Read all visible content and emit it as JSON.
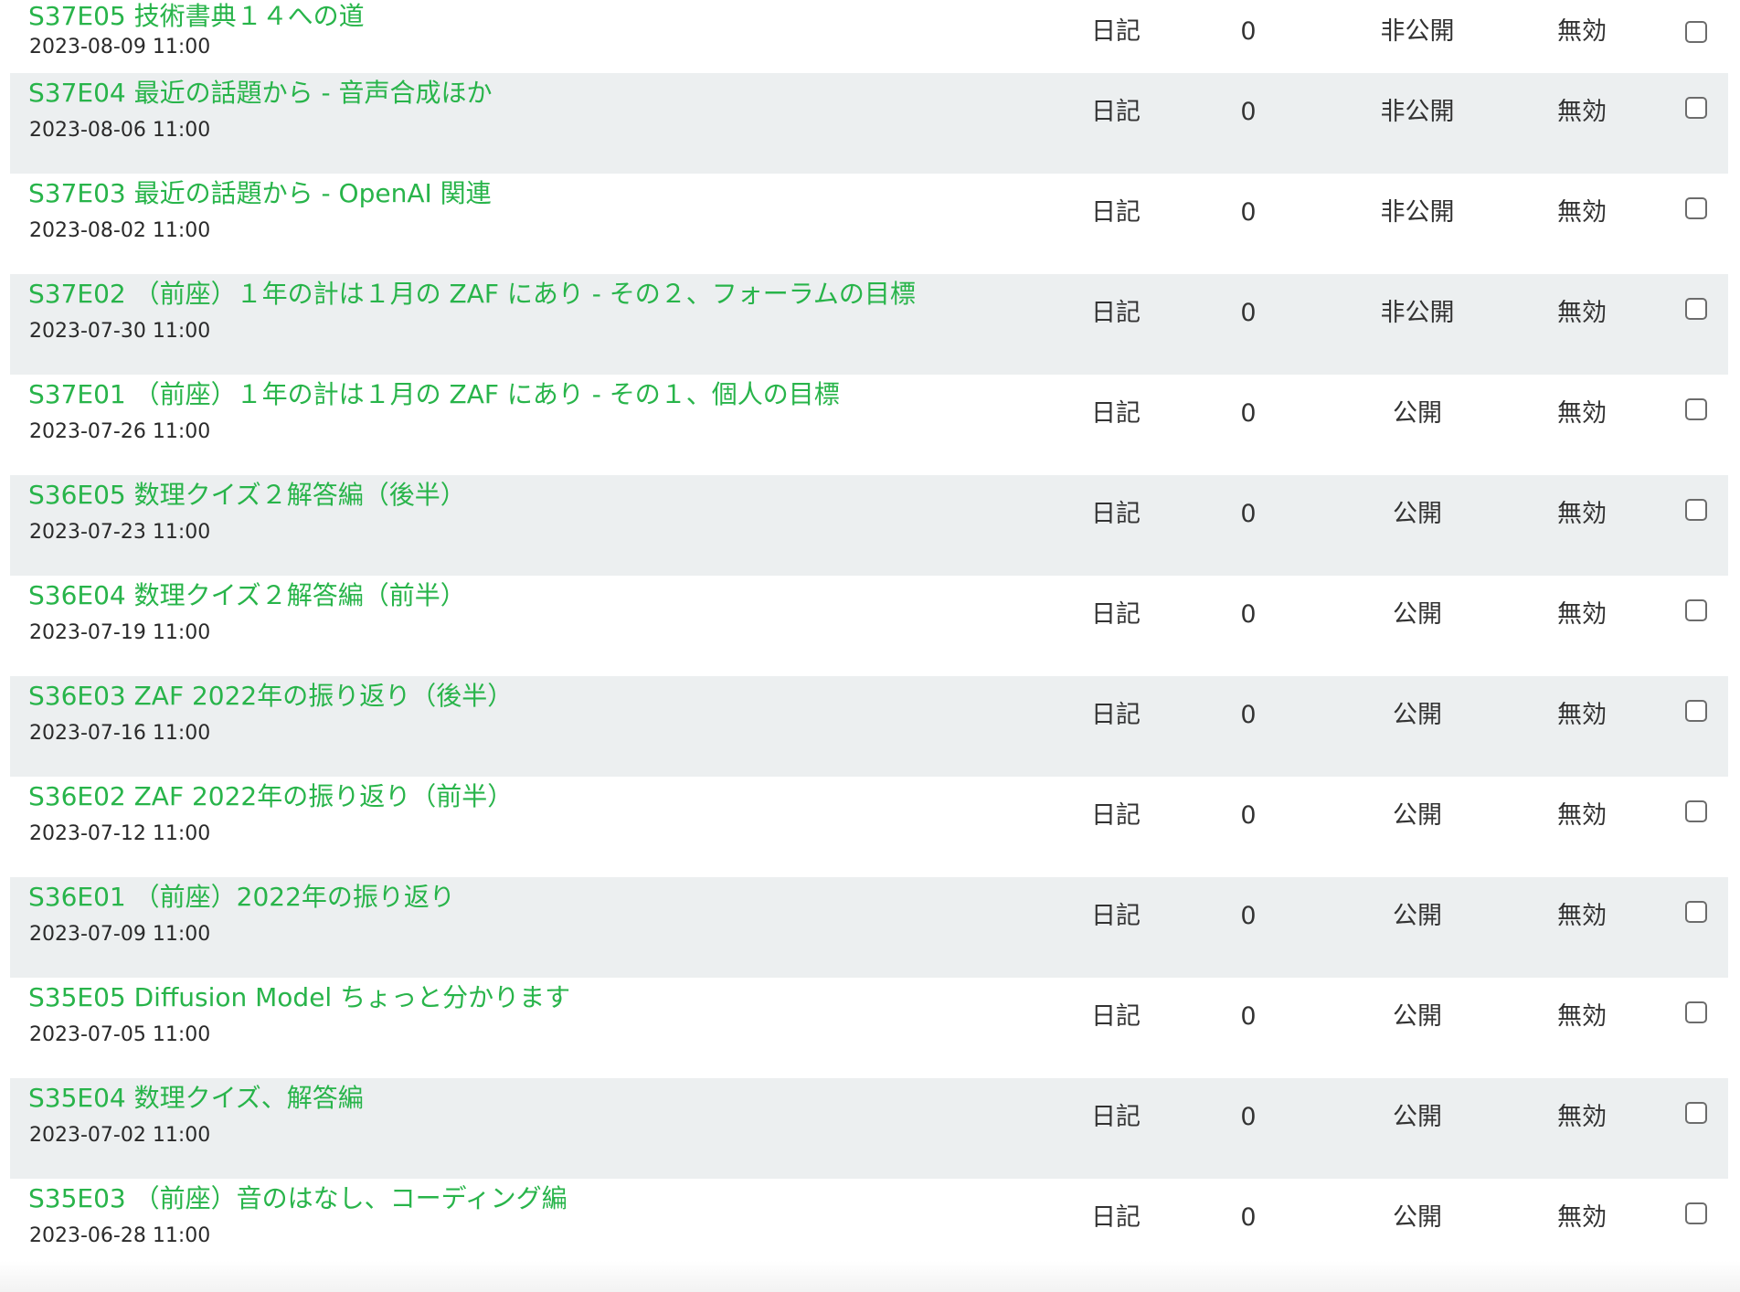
{
  "rows": [
    {
      "title": "S37E05 技術書典１４への道",
      "date": "2023-08-09 11:00",
      "category": "日記",
      "count": "0",
      "visibility": "非公開",
      "status": "無効"
    },
    {
      "title": "S37E04 最近の話題から - 音声合成ほか",
      "date": "2023-08-06 11:00",
      "category": "日記",
      "count": "0",
      "visibility": "非公開",
      "status": "無効"
    },
    {
      "title": "S37E03 最近の話題から - OpenAI 関連",
      "date": "2023-08-02 11:00",
      "category": "日記",
      "count": "0",
      "visibility": "非公開",
      "status": "無効"
    },
    {
      "title": "S37E02 （前座）１年の計は１月の ZAF にあり - その２、フォーラムの目標",
      "date": "2023-07-30 11:00",
      "category": "日記",
      "count": "0",
      "visibility": "非公開",
      "status": "無効"
    },
    {
      "title": "S37E01 （前座）１年の計は１月の ZAF にあり - その１、個人の目標",
      "date": "2023-07-26 11:00",
      "category": "日記",
      "count": "0",
      "visibility": "公開",
      "status": "無効"
    },
    {
      "title": "S36E05 数理クイズ２解答編（後半）",
      "date": "2023-07-23 11:00",
      "category": "日記",
      "count": "0",
      "visibility": "公開",
      "status": "無効"
    },
    {
      "title": "S36E04 数理クイズ２解答編（前半）",
      "date": "2023-07-19 11:00",
      "category": "日記",
      "count": "0",
      "visibility": "公開",
      "status": "無効"
    },
    {
      "title": "S36E03 ZAF 2022年の振り返り（後半）",
      "date": "2023-07-16 11:00",
      "category": "日記",
      "count": "0",
      "visibility": "公開",
      "status": "無効"
    },
    {
      "title": "S36E02 ZAF 2022年の振り返り（前半）",
      "date": "2023-07-12 11:00",
      "category": "日記",
      "count": "0",
      "visibility": "公開",
      "status": "無効"
    },
    {
      "title": "S36E01 （前座）2022年の振り返り",
      "date": "2023-07-09 11:00",
      "category": "日記",
      "count": "0",
      "visibility": "公開",
      "status": "無効"
    },
    {
      "title": "S35E05 Diffusion Model ちょっと分かります",
      "date": "2023-07-05 11:00",
      "category": "日記",
      "count": "0",
      "visibility": "公開",
      "status": "無効"
    },
    {
      "title": "S35E04 数理クイズ、解答編",
      "date": "2023-07-02 11:00",
      "category": "日記",
      "count": "0",
      "visibility": "公開",
      "status": "無効"
    },
    {
      "title": "S35E03 （前座）音のはなし、コーディング編",
      "date": "2023-06-28 11:00",
      "category": "日記",
      "count": "0",
      "visibility": "公開",
      "status": "無効"
    }
  ],
  "colors": {
    "title_link": "#28b44a",
    "alt_row_bg": "#eceff0",
    "text": "#333333"
  }
}
